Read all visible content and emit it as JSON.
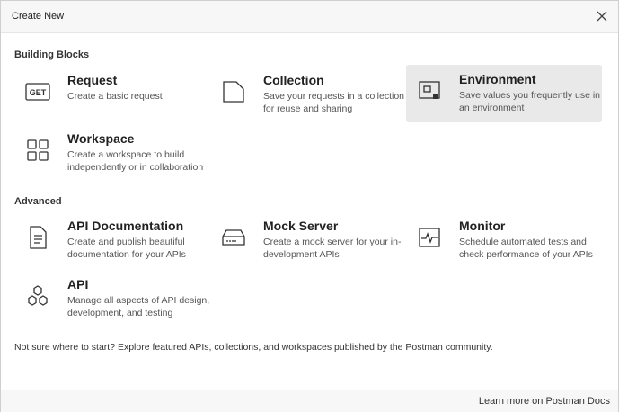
{
  "modal": {
    "title": "Create New",
    "close_icon": "close-icon"
  },
  "sections": {
    "building_blocks": "Building Blocks",
    "advanced": "Advanced"
  },
  "building_blocks": [
    {
      "name": "Request",
      "desc": "Create a basic request",
      "icon": "get-request-icon",
      "icon_text": "GET"
    },
    {
      "name": "Collection",
      "desc": "Save your requests in a collection for reuse and sharing",
      "icon": "collection-folder-icon"
    },
    {
      "name": "Environment",
      "desc": "Save values you frequently use in an environment",
      "icon": "environment-icon",
      "selected": true
    },
    {
      "name": "Workspace",
      "desc": "Create a workspace to build independently or in collaboration",
      "icon": "workspace-grid-icon"
    }
  ],
  "advanced": [
    {
      "name": "API Documentation",
      "desc": "Create and publish beautiful documentation for your APIs",
      "icon": "document-icon"
    },
    {
      "name": "Mock Server",
      "desc": "Create a mock server for your in-development APIs",
      "icon": "server-icon"
    },
    {
      "name": "Monitor",
      "desc": "Schedule automated tests and check performance of your APIs",
      "icon": "monitor-pulse-icon"
    },
    {
      "name": "API",
      "desc": "Manage all aspects of API design, development, and testing",
      "icon": "api-hexagon-icon"
    }
  ],
  "footer": {
    "note": "Not sure where to start? Explore featured APIs, collections, and workspaces published by the Postman community.",
    "link": "Learn more on Postman Docs"
  },
  "colors": {
    "selected_bg": "#e9e9e9",
    "header_bg": "#f7f7f7",
    "text": "#212121"
  }
}
